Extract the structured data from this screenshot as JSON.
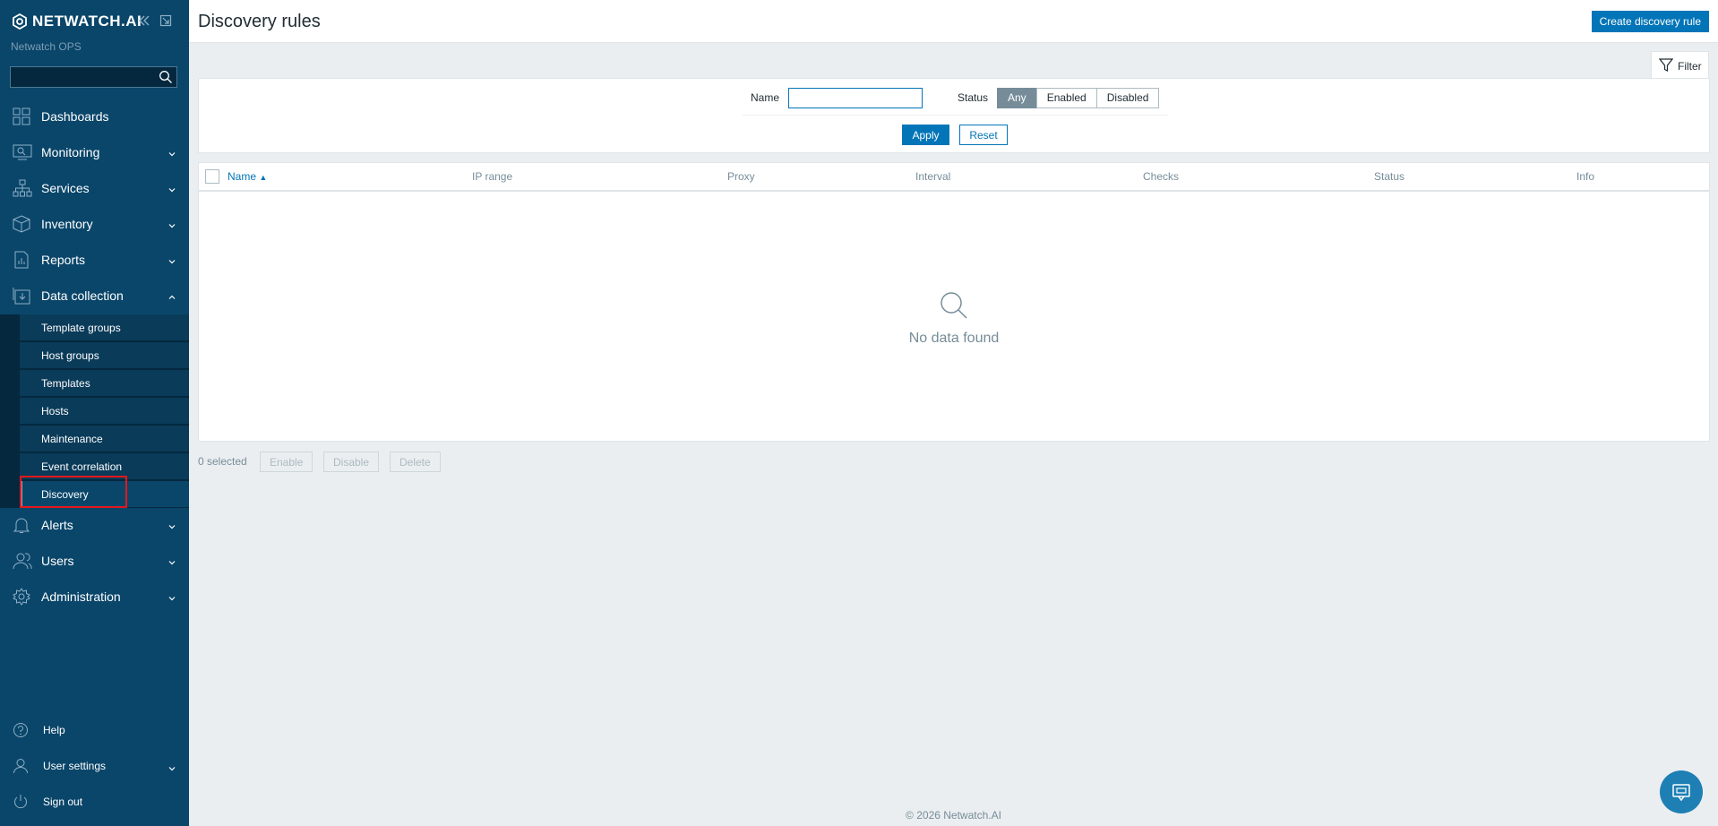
{
  "sidebar": {
    "brand": "NETWATCH.AI",
    "subtitle": "Netwatch OPS",
    "search_value": "",
    "nav": [
      {
        "label": "Dashboards",
        "icon": "dashboards-icon",
        "expandable": false
      },
      {
        "label": "Monitoring",
        "icon": "monitoring-icon",
        "expandable": true
      },
      {
        "label": "Services",
        "icon": "services-icon",
        "expandable": true
      },
      {
        "label": "Inventory",
        "icon": "inventory-icon",
        "expandable": true
      },
      {
        "label": "Reports",
        "icon": "reports-icon",
        "expandable": true
      },
      {
        "label": "Data collection",
        "icon": "data-collection-icon",
        "expandable": true,
        "expanded": true
      }
    ],
    "submenu": [
      "Template groups",
      "Host groups",
      "Templates",
      "Hosts",
      "Maintenance",
      "Event correlation",
      "Discovery"
    ],
    "active_submenu": "Discovery",
    "nav_after": [
      {
        "label": "Alerts",
        "icon": "bell-icon"
      },
      {
        "label": "Users",
        "icon": "users-icon"
      },
      {
        "label": "Administration",
        "icon": "gear-icon"
      }
    ],
    "bottom": [
      {
        "label": "Help",
        "icon": "help-icon"
      },
      {
        "label": "User settings",
        "icon": "user-icon"
      },
      {
        "label": "Sign out",
        "icon": "power-icon"
      }
    ]
  },
  "header": {
    "title": "Discovery rules",
    "create_label": "Create discovery rule"
  },
  "filter": {
    "tab_label": "Filter",
    "name_label": "Name",
    "name_value": "",
    "status_label": "Status",
    "status_options": [
      "Any",
      "Enabled",
      "Disabled"
    ],
    "status_selected": "Any",
    "apply_label": "Apply",
    "reset_label": "Reset"
  },
  "table": {
    "columns": [
      "Name",
      "IP range",
      "Proxy",
      "Interval",
      "Checks",
      "Status",
      "Info"
    ],
    "sort_column": "Name",
    "sort_direction": "asc",
    "empty_text": "No data found"
  },
  "actions": {
    "selected_text": "0 selected",
    "buttons": [
      "Enable",
      "Disable",
      "Delete"
    ]
  },
  "footer": {
    "copyright": "© 2026 Netwatch.AI"
  },
  "colors": {
    "sidebar_bg": "#0a466a",
    "accent": "#0275b8",
    "highlight": "#e3161c"
  }
}
